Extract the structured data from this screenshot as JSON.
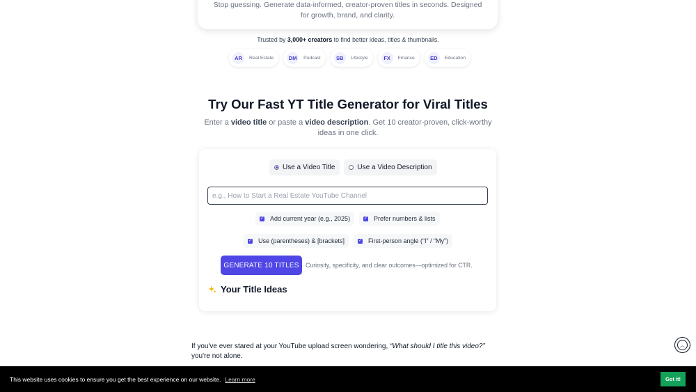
{
  "hero": {
    "blurb": "Stop guessing. Generate data-informed, creator-proven titles in seconds. Designed for growth, brand, and clarity."
  },
  "trusted": {
    "prefix": "Trusted by ",
    "count": "3,000+ creators",
    "suffix": " to find better ideas, titles & thumbnails."
  },
  "creators": [
    {
      "initials": "AR",
      "category": "Real Estate"
    },
    {
      "initials": "DM",
      "category": "Podcast"
    },
    {
      "initials": "SB",
      "category": "Lifestyle"
    },
    {
      "initials": "FX",
      "category": "Finance"
    },
    {
      "initials": "ED",
      "category": "Education"
    }
  ],
  "section": {
    "title": "Try Our Fast YT Title Generator for Viral Titles",
    "sub_1": "Enter a ",
    "sub_b1": "video title",
    "sub_2": " or paste a ",
    "sub_b2": "video description",
    "sub_3": ". Get 10 creator-proven, click-worthy ideas in one click."
  },
  "generator": {
    "mode_title": "Use a Video Title",
    "mode_description": "Use a Video Description",
    "input_placeholder": "e.g., How to Start a Real Estate YouTube Channel",
    "options": {
      "current_year": "Add current year (e.g., 2025)",
      "numbers_lists": "Prefer numbers & lists",
      "brackets": "Use (parentheses) & [brackets]",
      "first_person": "First-person angle (“I” / “My”)"
    },
    "button_label": "GENERATE 10 TITLES",
    "hint": "Curiosity, specificity, and clear outcomes—optimized for CTR.",
    "ideas_heading": "Your Title Ideas"
  },
  "article": {
    "p1_a": "If you've ever stared at your YouTube upload screen wondering, ",
    "p1_quote": "“What should I title this video?”",
    "p1_b": " you're not alone."
  },
  "cookie": {
    "text": "This website uses cookies to ensure you get the best experience on our website.",
    "link": "Learn more",
    "button": "Got it!"
  },
  "colors": {
    "accent": "#4f46e5",
    "cookie_bg": "#000000",
    "cookie_button": "#14a25a"
  }
}
